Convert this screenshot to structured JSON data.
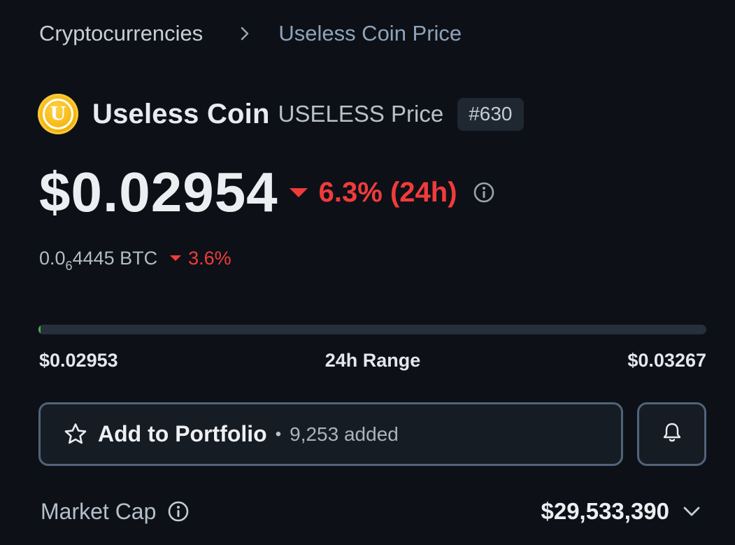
{
  "breadcrumb": {
    "root": "Cryptocurrencies",
    "current": "Useless Coin Price"
  },
  "coin": {
    "logo_letter": "U",
    "name": "Useless Coin",
    "symbol_label": "USELESS Price",
    "rank": "#630"
  },
  "price": {
    "usd": "$0.02954",
    "change_24h": "6.3% (24h)",
    "change_direction": "down",
    "btc_prefix": "0.0",
    "btc_subscript": "6",
    "btc_suffix": "4445 BTC",
    "btc_change": "3.6%"
  },
  "range": {
    "low": "$0.02953",
    "title": "24h Range",
    "high": "$0.03267",
    "position_fraction": 0.003
  },
  "portfolio": {
    "label": "Add to Portfolio",
    "separator": "•",
    "count": "9,253 added"
  },
  "market_cap": {
    "label": "Market Cap",
    "value": "$29,533,390"
  },
  "colors": {
    "background": "#0d1117",
    "negative": "#f23b3b",
    "range_fill": "#4caf50",
    "button_border": "#51637a",
    "coin_gold": "#f5b50a"
  },
  "icons": [
    "chevron-right-icon",
    "info-icon",
    "star-icon",
    "bell-icon",
    "chevron-down-icon"
  ]
}
